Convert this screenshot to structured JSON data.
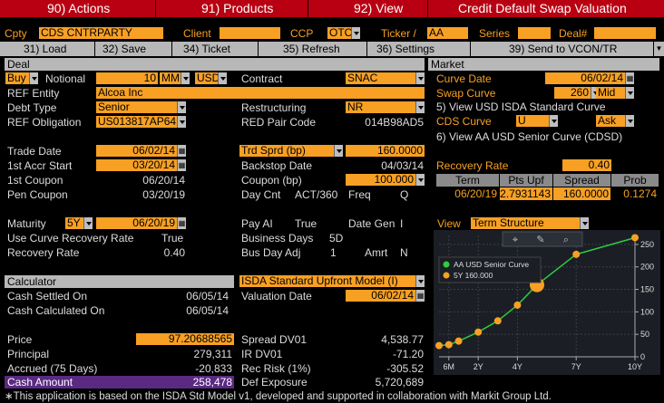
{
  "menu": {
    "actions": "90) Actions",
    "products": "91) Products",
    "view": "92) View",
    "title": "Credit Default Swap Valuation"
  },
  "header": {
    "cpty_label": "Cpty",
    "cpty_value": "CDS CNTRPARTY",
    "client_label": "Client",
    "client_value": "",
    "ccp_label": "CCP",
    "ccp_value": "OTC",
    "ticker_label": "Ticker /",
    "ticker_value": "AA",
    "series_label": "Series",
    "series_value": "",
    "deal_label": "Deal#",
    "deal_value": ""
  },
  "toolbar": {
    "load": "31) Load",
    "save": "32) Save",
    "ticket": "34) Ticket",
    "refresh": "35) Refresh",
    "settings": "36) Settings",
    "send": "39) Send to VCON/TR"
  },
  "deal": {
    "section": "Deal",
    "side": "Buy",
    "notional_label": "Notional",
    "notional_value": "10",
    "notional_unit": "MM",
    "currency": "USD",
    "contract_label": "Contract",
    "contract_value": "SNAC",
    "ref_entity_label": "REF Entity",
    "ref_entity_value": "Alcoa Inc",
    "debt_type_label": "Debt Type",
    "debt_type_value": "Senior",
    "restructuring_label": "Restructuring",
    "restructuring_value": "NR",
    "ref_obligation_label": "REF Obligation",
    "ref_obligation_value": "US013817AP64",
    "red_pair_label": "RED Pair Code",
    "red_pair_value": "014B98AD5",
    "trade_date_label": "Trade Date",
    "trade_date_value": "06/02/14",
    "trd_sprd_label": "Trd Sprd (bp)",
    "trd_sprd_value": "160.0000",
    "accr_start_label": "1st Accr Start",
    "accr_start_value": "03/20/14",
    "backstop_label": "Backstop Date",
    "backstop_value": "04/03/14",
    "first_coupon_label": "1st Coupon",
    "first_coupon_value": "06/20/14",
    "coupon_label": "Coupon (bp)",
    "coupon_value": "100.000",
    "pen_coupon_label": "Pen Coupon",
    "pen_coupon_value": "03/20/19",
    "day_cnt_label": "Day Cnt",
    "day_cnt_value": "ACT/360",
    "freq_label": "Freq",
    "freq_value": "Q",
    "maturity_label": "Maturity",
    "maturity_tenor": "5Y",
    "maturity_value": "06/20/19",
    "pay_ai_label": "Pay AI",
    "pay_ai_value": "True",
    "date_gen_label": "Date Gen",
    "date_gen_value": "I",
    "use_curve_label": "Use Curve Recovery Rate",
    "use_curve_value": "True",
    "business_days_label": "Business Days",
    "business_days_value": "5D",
    "recovery_label": "Recovery Rate",
    "recovery_value": "0.40",
    "bus_day_adj_label": "Bus Day Adj",
    "bus_day_adj_value": "1",
    "amrt_label": "Amrt",
    "amrt_value": "N"
  },
  "calculator": {
    "section": "Calculator",
    "model": "ISDA Standard Upfront Model (I)",
    "cash_settled_label": "Cash Settled On",
    "cash_settled_value": "06/05/14",
    "valuation_date_label": "Valuation Date",
    "valuation_date_value": "06/02/14",
    "cash_calc_label": "Cash Calculated On",
    "cash_calc_value": "06/05/14",
    "price_label": "Price",
    "price_value": "97.20688565",
    "spread_dv01_label": "Spread DV01",
    "spread_dv01_value": "4,538.77",
    "principal_label": "Principal",
    "principal_value": "279,311",
    "ir_dv01_label": "IR DV01",
    "ir_dv01_value": "-71.20",
    "accrued_label": "Accrued (75 Days)",
    "accrued_value": "-20,833",
    "rec_risk_label": "Rec Risk (1%)",
    "rec_risk_value": "-305.52",
    "cash_amount_label": "Cash Amount",
    "cash_amount_value": "258,478",
    "def_exposure_label": "Def Exposure",
    "def_exposure_value": "5,720,689"
  },
  "market": {
    "section": "Market",
    "curve_date_label": "Curve Date",
    "curve_date_value": "06/02/14",
    "swap_curve_label": "Swap Curve",
    "swap_curve_value": "260",
    "swap_curve_side": "Mid",
    "view_usd_isda": "5) View USD ISDA Standard Curve",
    "cds_curve_label": "CDS Curve",
    "cds_curve_value": "U",
    "cds_curve_side": "Ask",
    "view_aa_usd": "6) View AA USD Senior Curve (CDSD)",
    "recovery_label": "Recovery Rate",
    "recovery_value": "0.40",
    "table_headers": [
      "Term",
      "Pts Upf",
      "Spread",
      "Prob"
    ],
    "table_row": [
      "06/20/19",
      "2.7931143",
      "160.0000",
      "0.1274"
    ],
    "view_label": "View",
    "view_value": "Term Structure"
  },
  "chart_data": {
    "type": "line",
    "legend": [
      {
        "name": "AA USD Senior Curve",
        "color": "#2ecc40"
      },
      {
        "name": "5Y 160.000",
        "color": "#f7a024"
      }
    ],
    "x_ticks": [
      "6M",
      "2Y",
      "4Y",
      "7Y",
      "10Y"
    ],
    "y_ticks": [
      "0",
      "50",
      "100",
      "150",
      "200",
      "250"
    ],
    "ylim": [
      0,
      270
    ],
    "xlim": [
      0,
      10
    ],
    "series": [
      {
        "name": "AA USD Senior Curve",
        "x": [
          0,
          0.5,
          1,
          2,
          3,
          4,
          5,
          7,
          10
        ],
        "y": [
          25,
          27,
          35,
          55,
          80,
          115,
          160,
          228,
          265
        ]
      }
    ],
    "highlight": {
      "x": 5,
      "y": 160,
      "label": "5Y 160.000"
    },
    "toolbar_icons": [
      "crosshair-icon",
      "pencil-icon",
      "zoom-icon"
    ]
  },
  "footer": {
    "note": "∗This application is based on the ISDA Std Model v1, developed and supported in collaboration with Markit Group Ltd."
  },
  "colors": {
    "accent": "#f7a024",
    "menu_red": "#b80012",
    "header_grey": "#b8b8b8",
    "cash_highlight": "#5a2a82"
  }
}
